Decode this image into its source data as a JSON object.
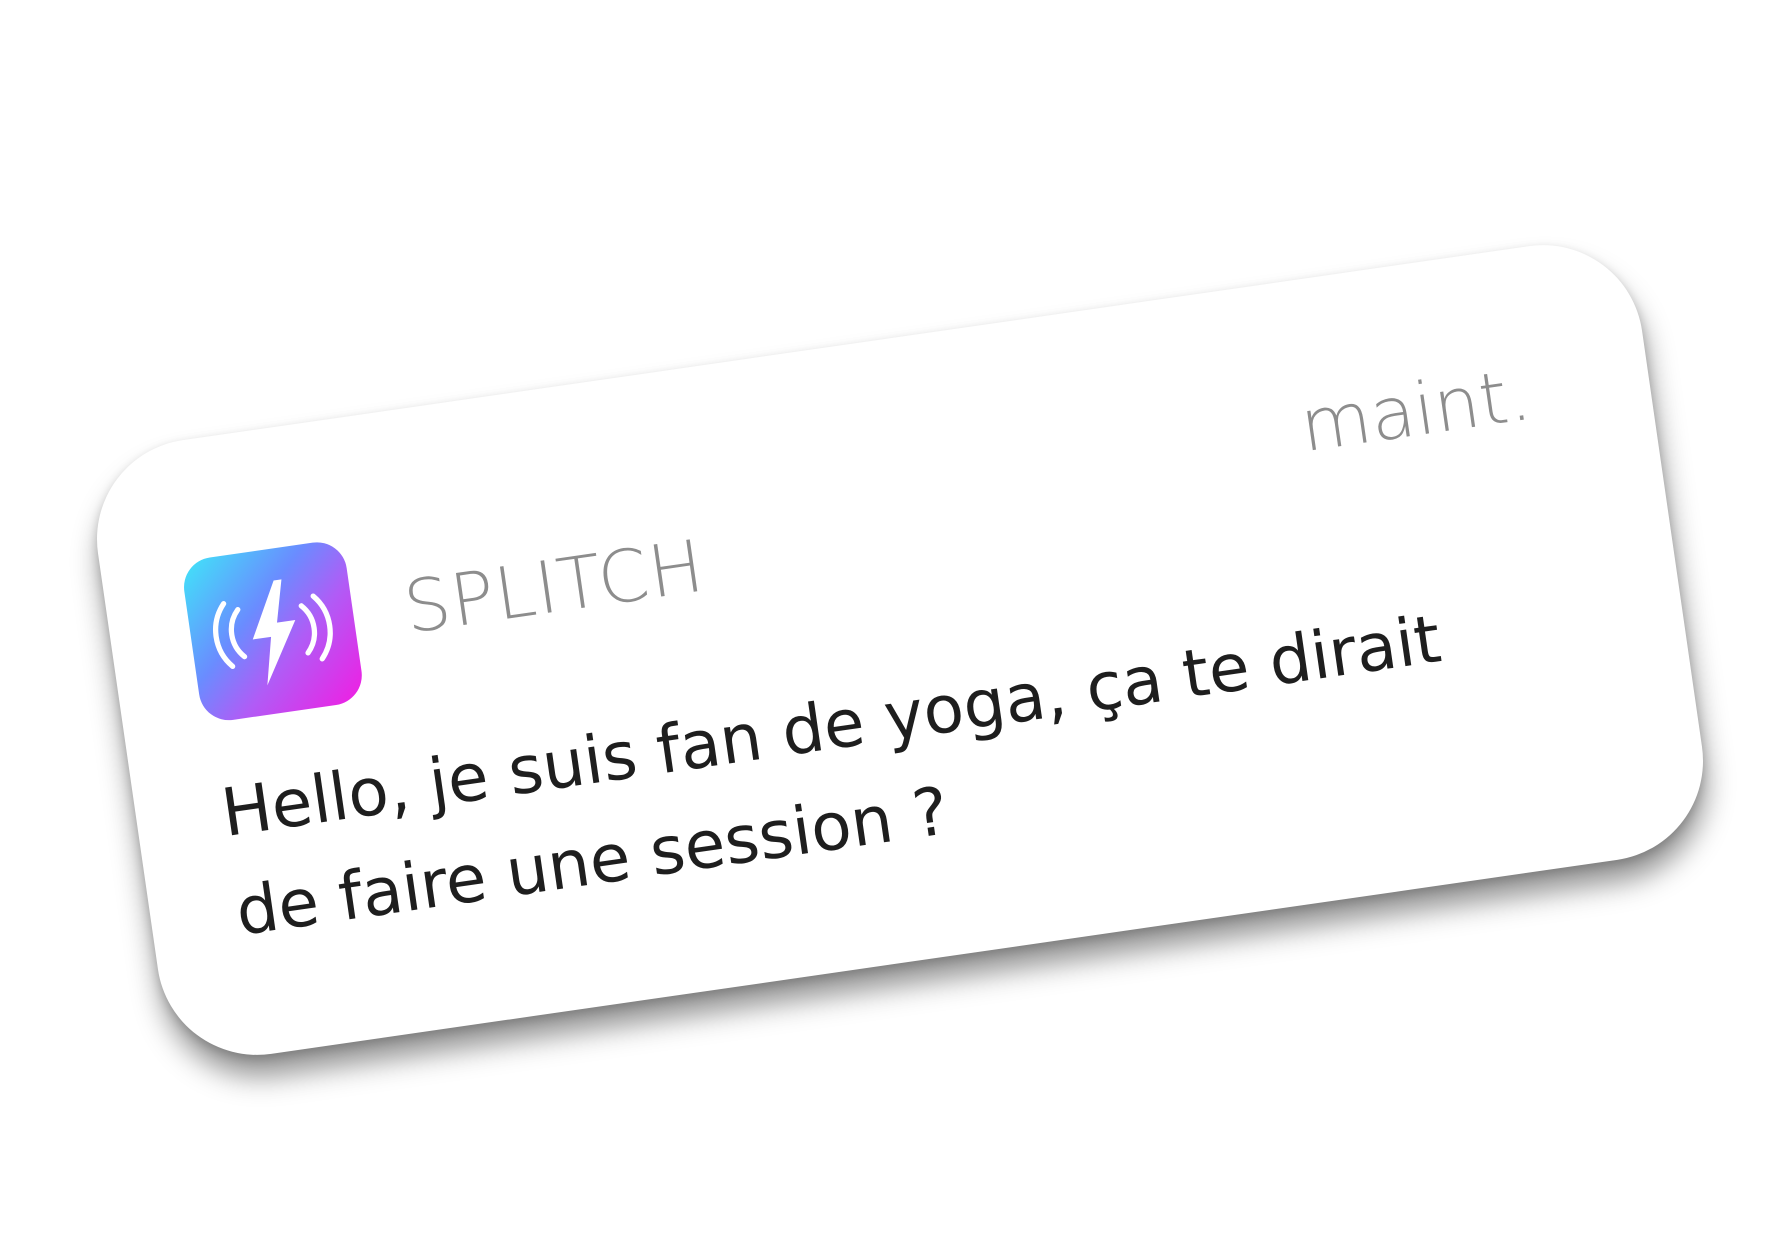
{
  "notification": {
    "app_name": "SPLITCH",
    "timestamp": "maint.",
    "message": "Hello, je suis fan de yoga, ça te dirait de faire une session ?",
    "icon": "lightning-bolt-icon"
  },
  "colors": {
    "card_background": "#ffffff",
    "secondary_text": "#8d8d8d",
    "primary_text": "#1e1e1e",
    "icon_gradient_start": "#3fe6f8",
    "icon_gradient_mid": "#b05cf6",
    "icon_gradient_end": "#f21ce2"
  }
}
